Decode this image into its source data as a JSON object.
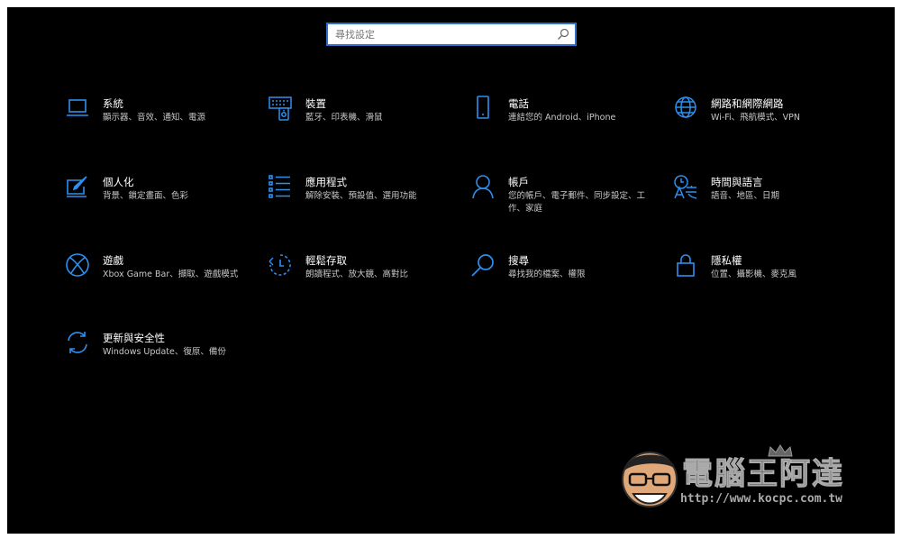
{
  "search": {
    "placeholder": "尋找設定"
  },
  "colors": {
    "accent": "#2d8ff0",
    "background": "#000000"
  },
  "categories": [
    {
      "icon": "laptop-icon",
      "title": "系統",
      "description": "顯示器、音效、通知、電源"
    },
    {
      "icon": "keyboard-icon",
      "title": "裝置",
      "description": "藍牙、印表機、滑鼠"
    },
    {
      "icon": "phone-icon",
      "title": "電話",
      "description": "連結您的 Android、iPhone"
    },
    {
      "icon": "globe-icon",
      "title": "網路和網際網路",
      "description": "Wi-Fi、飛航模式、VPN"
    },
    {
      "icon": "paint-icon",
      "title": "個人化",
      "description": "背景、鎖定畫面、色彩"
    },
    {
      "icon": "apps-list-icon",
      "title": "應用程式",
      "description": "解除安裝、預設值、選用功能"
    },
    {
      "icon": "person-icon",
      "title": "帳戶",
      "description": "您的帳戶、電子郵件、同步設定、工作、家庭"
    },
    {
      "icon": "time-language-icon",
      "title": "時間與語言",
      "description": "語音、地區、日期"
    },
    {
      "icon": "xbox-icon",
      "title": "遊戲",
      "description": "Xbox Game Bar、擷取、遊戲模式"
    },
    {
      "icon": "ease-of-access-icon",
      "title": "輕鬆存取",
      "description": "朗讀程式、放大鏡、高對比"
    },
    {
      "icon": "search-icon",
      "title": "搜尋",
      "description": "尋找我的檔案、權限"
    },
    {
      "icon": "lock-icon",
      "title": "隱私權",
      "description": "位置、攝影機、麥克風"
    },
    {
      "icon": "sync-icon",
      "title": "更新與安全性",
      "description": "Windows Update、復原、備份"
    }
  ],
  "watermark": {
    "brand": "電腦王阿達",
    "url": "http://www.kocpc.com.tw"
  }
}
